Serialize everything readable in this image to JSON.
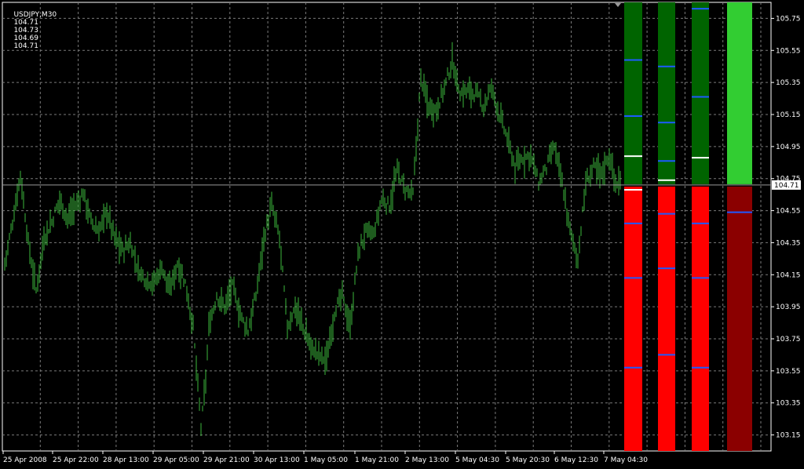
{
  "header": {
    "symbol": "USDJPY,M30",
    "open": "104.71",
    "high": "104.73",
    "low": "104.69",
    "close": "104.71"
  },
  "chart_data": {
    "type": "bar",
    "subtype": "ohlc",
    "symbol": "USDJPY",
    "timeframe": "M30",
    "price_range": [
      103.05,
      105.85
    ],
    "y_ticks": [
      "105.75",
      "105.55",
      "105.35",
      "105.15",
      "104.95",
      "104.75",
      "104.55",
      "104.35",
      "104.15",
      "103.95",
      "103.75",
      "103.55",
      "103.35",
      "103.15"
    ],
    "x_ticks": [
      "25 Apr 2008",
      "25 Apr 22:00",
      "28 Apr 13:00",
      "29 Apr 05:00",
      "29 Apr 21:00",
      "30 Apr 13:00",
      "1 May 05:00",
      "1 May 21:00",
      "2 May 13:00",
      "5 May 04:30",
      "5 May 20:30",
      "6 May 12:30",
      "7 May 04:30"
    ],
    "current_price": "104.71",
    "grid": true,
    "series_color": "#3cb83c",
    "price_path": [
      [
        0,
        104.22
      ],
      [
        10,
        104.48
      ],
      [
        20,
        104.78
      ],
      [
        30,
        104.35
      ],
      [
        40,
        104.05
      ],
      [
        50,
        104.38
      ],
      [
        60,
        104.48
      ],
      [
        70,
        104.62
      ],
      [
        80,
        104.5
      ],
      [
        90,
        104.58
      ],
      [
        100,
        104.66
      ],
      [
        110,
        104.48
      ],
      [
        120,
        104.42
      ],
      [
        130,
        104.55
      ],
      [
        140,
        104.38
      ],
      [
        150,
        104.3
      ],
      [
        160,
        104.35
      ],
      [
        170,
        104.18
      ],
      [
        180,
        104.12
      ],
      [
        190,
        104.1
      ],
      [
        200,
        104.2
      ],
      [
        210,
        104.05
      ],
      [
        220,
        104.22
      ],
      [
        230,
        104.1
      ],
      [
        240,
        103.82
      ],
      [
        250,
        103.2
      ],
      [
        255,
        103.42
      ],
      [
        260,
        103.82
      ],
      [
        270,
        104.02
      ],
      [
        280,
        103.95
      ],
      [
        290,
        104.08
      ],
      [
        300,
        103.9
      ],
      [
        310,
        103.8
      ],
      [
        320,
        104.02
      ],
      [
        330,
        104.38
      ],
      [
        340,
        104.58
      ],
      [
        350,
        104.38
      ],
      [
        360,
        103.82
      ],
      [
        370,
        103.95
      ],
      [
        380,
        103.82
      ],
      [
        390,
        103.7
      ],
      [
        400,
        103.65
      ],
      [
        410,
        103.62
      ],
      [
        420,
        103.92
      ],
      [
        430,
        104.02
      ],
      [
        440,
        103.82
      ],
      [
        450,
        104.28
      ],
      [
        460,
        104.42
      ],
      [
        470,
        104.4
      ],
      [
        480,
        104.62
      ],
      [
        490,
        104.58
      ],
      [
        500,
        104.8
      ],
      [
        510,
        104.68
      ],
      [
        520,
        104.65
      ],
      [
        530,
        105.38
      ],
      [
        540,
        105.2
      ],
      [
        550,
        105.18
      ],
      [
        560,
        105.32
      ],
      [
        570,
        105.48
      ],
      [
        580,
        105.28
      ],
      [
        590,
        105.3
      ],
      [
        600,
        105.28
      ],
      [
        610,
        105.2
      ],
      [
        620,
        105.32
      ],
      [
        630,
        105.15
      ],
      [
        640,
        105.0
      ],
      [
        650,
        104.82
      ],
      [
        660,
        104.88
      ],
      [
        670,
        104.9
      ],
      [
        680,
        104.72
      ],
      [
        690,
        104.82
      ],
      [
        700,
        104.95
      ],
      [
        710,
        104.72
      ],
      [
        720,
        104.42
      ],
      [
        730,
        104.25
      ],
      [
        740,
        104.72
      ],
      [
        750,
        104.82
      ],
      [
        760,
        104.78
      ],
      [
        770,
        104.9
      ],
      [
        778,
        104.72
      ],
      [
        785,
        104.71
      ]
    ],
    "indicator_columns": [
      {
        "above_color": "#006400",
        "below_color": "#ff0000",
        "above_levels": [
          105.49,
          105.14,
          104.89
        ],
        "below_levels": [
          104.68,
          104.47,
          104.13,
          103.57
        ]
      },
      {
        "above_color": "#006400",
        "below_color": "#ff0000",
        "above_levels": [
          105.45,
          105.1,
          104.86,
          104.74
        ],
        "below_levels": [
          104.53,
          104.19,
          103.65
        ]
      },
      {
        "above_color": "#006400",
        "below_color": "#ff0000",
        "above_levels": [
          105.81,
          105.26,
          104.88
        ],
        "below_levels": [
          104.47,
          104.13,
          103.57
        ]
      },
      {
        "above_color": "#32cd32",
        "below_color": "#8b0000",
        "above_levels": [],
        "below_levels": [
          104.54
        ]
      }
    ]
  }
}
